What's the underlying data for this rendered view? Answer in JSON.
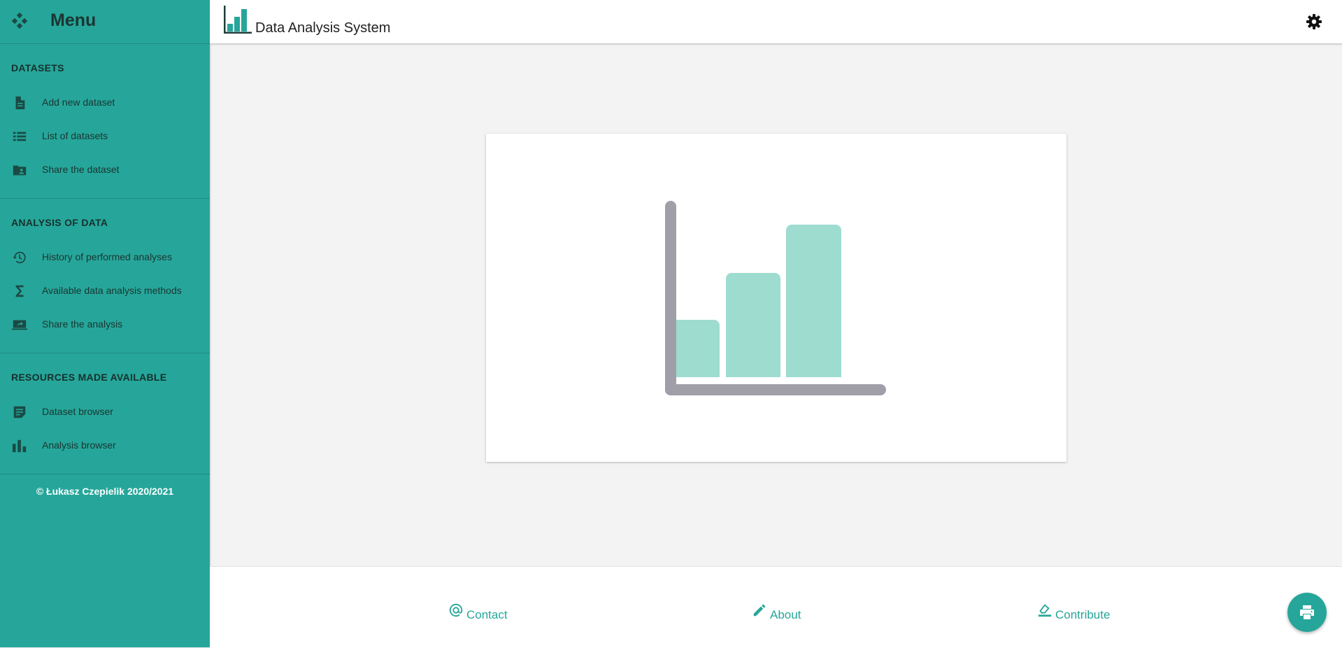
{
  "sidebar": {
    "title": "Menu",
    "sections": [
      {
        "title": "DATASETS",
        "items": [
          {
            "label": "Add new dataset",
            "icon": "file-icon"
          },
          {
            "label": "List of datasets",
            "icon": "list-icon"
          },
          {
            "label": "Share the dataset",
            "icon": "folder-share-icon"
          }
        ]
      },
      {
        "title": "ANALYSIS OF DATA",
        "items": [
          {
            "label": "History of performed analyses",
            "icon": "history-icon"
          },
          {
            "label": "Available data analysis methods",
            "icon": "sigma-icon"
          },
          {
            "label": "Share the analysis",
            "icon": "screen-share-icon"
          }
        ]
      },
      {
        "title": "RESOURCES MADE AVAILABLE",
        "items": [
          {
            "label": "Dataset browser",
            "icon": "note-icon"
          },
          {
            "label": "Analysis browser",
            "icon": "bar-chart-icon"
          }
        ]
      }
    ],
    "footer": "© Łukasz Czepielik 2020/2021"
  },
  "header": {
    "title": "Data Analysis System",
    "logo_icon": "bar-chart-logo-icon",
    "settings_icon": "gear-icon"
  },
  "footer": {
    "links": [
      {
        "label": "Contact",
        "icon": "at-icon"
      },
      {
        "label": "About",
        "icon": "pencil-icon"
      },
      {
        "label": "Contribute",
        "icon": "eraser-icon"
      }
    ],
    "fab_icon": "print-icon"
  },
  "colors": {
    "accent": "#26a69a",
    "illustration_bar": "#9edcd0",
    "illustration_axis": "#a09fa8"
  }
}
